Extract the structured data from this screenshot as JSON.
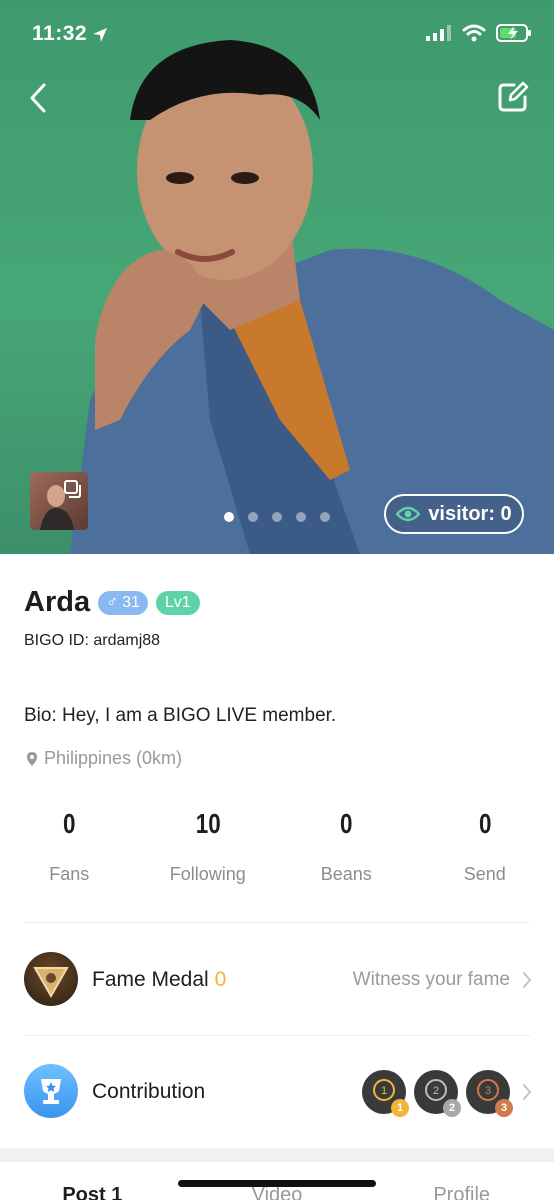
{
  "status_bar": {
    "time": "11:32"
  },
  "hero": {
    "visitor_label": "visitor: 0",
    "page_dots": 5,
    "active_dot": 1
  },
  "profile": {
    "name": "Arda",
    "age": "31",
    "gender_symbol": "♂",
    "level": "Lv1",
    "bigo_id": "BIGO ID: ardamj88",
    "bio": "Bio: Hey, I am a BIGO LIVE member.",
    "location": "Philippines (0km)"
  },
  "stats": [
    {
      "value": "0",
      "label": "Fans"
    },
    {
      "value": "10",
      "label": "Following"
    },
    {
      "value": "0",
      "label": "Beans"
    },
    {
      "value": "0",
      "label": "Send"
    }
  ],
  "fame_medal": {
    "label": "Fame Medal",
    "count": "0",
    "hint": "Witness your fame"
  },
  "contribution": {
    "label": "Contribution",
    "ranks": [
      "1",
      "2",
      "3"
    ]
  },
  "tabs": [
    {
      "label": "Post 1",
      "active": true
    },
    {
      "label": "Video",
      "active": false
    },
    {
      "label": "Profile",
      "active": false
    }
  ],
  "colors": {
    "hero_green": "#47a776",
    "age_badge": "#8ab8f3",
    "level_badge": "#5fd3a8",
    "fame_count": "#f2b535",
    "rank_gold": "#f2b535",
    "rank_silver": "#a8a8a8",
    "rank_bronze": "#d07a4e"
  }
}
